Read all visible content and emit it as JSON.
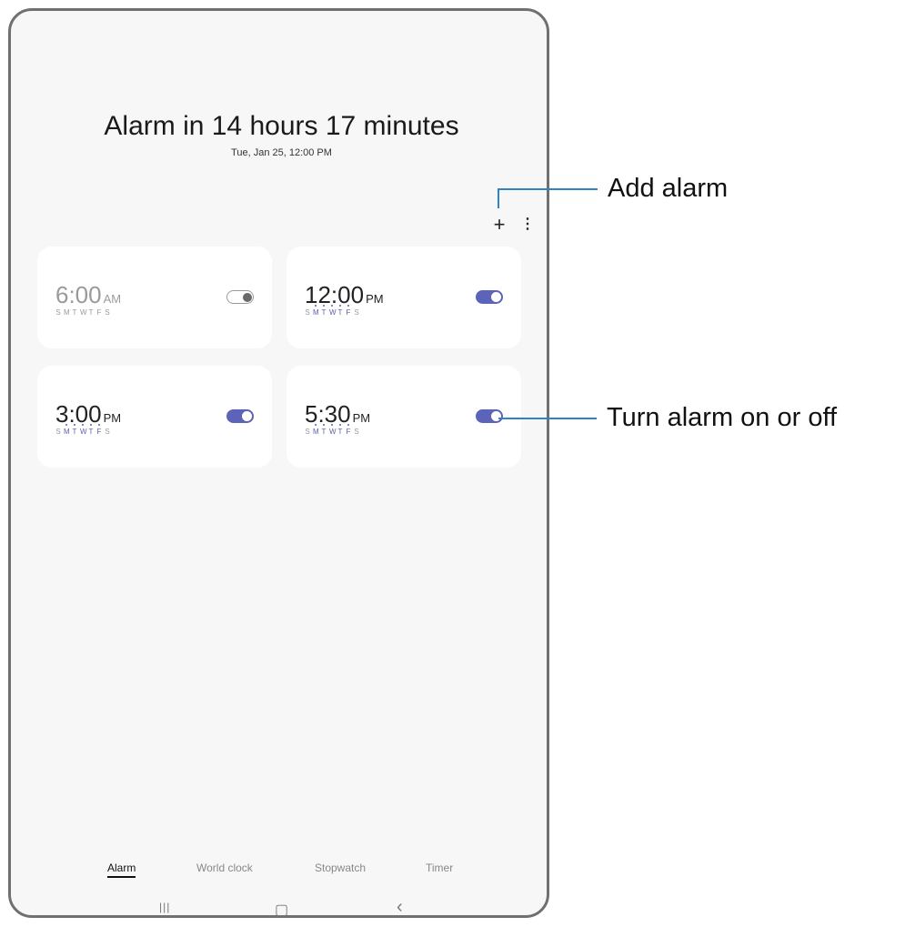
{
  "header": {
    "title": "Alarm in 14 hours 17 minutes",
    "subtitle": "Tue, Jan 25, 12:00 PM"
  },
  "toolbar": {
    "add_icon": "plus-icon",
    "more_icon": "more-vertical-icon",
    "add_glyph": "+",
    "more_glyph": "⋮"
  },
  "alarms": [
    {
      "time": "6:00",
      "ampm": "AM",
      "enabled": false,
      "days": [
        "S",
        "M",
        "T",
        "W",
        "T",
        "F",
        "S"
      ],
      "active_days": [
        false,
        true,
        true,
        true,
        true,
        true,
        false
      ]
    },
    {
      "time": "12:00",
      "ampm": "PM",
      "enabled": true,
      "days": [
        "S",
        "M",
        "T",
        "W",
        "T",
        "F",
        "S"
      ],
      "active_days": [
        false,
        true,
        true,
        true,
        true,
        true,
        false
      ]
    },
    {
      "time": "3:00",
      "ampm": "PM",
      "enabled": true,
      "days": [
        "S",
        "M",
        "T",
        "W",
        "T",
        "F",
        "S"
      ],
      "active_days": [
        false,
        true,
        true,
        true,
        true,
        true,
        false
      ]
    },
    {
      "time": "5:30",
      "ampm": "PM",
      "enabled": true,
      "days": [
        "S",
        "M",
        "T",
        "W",
        "T",
        "F",
        "S"
      ],
      "active_days": [
        false,
        true,
        true,
        true,
        true,
        true,
        false
      ]
    }
  ],
  "tabs": [
    {
      "label": "Alarm",
      "active": true
    },
    {
      "label": "World clock",
      "active": false
    },
    {
      "label": "Stopwatch",
      "active": false
    },
    {
      "label": "Timer",
      "active": false
    }
  ],
  "navbar": {
    "recent": "|||",
    "home": "▢",
    "back": "‹"
  },
  "callouts": {
    "add_alarm": "Add alarm",
    "toggle": "Turn alarm on or off"
  },
  "colors": {
    "accent": "#5c63b8",
    "callout_line": "#2f82c4"
  }
}
